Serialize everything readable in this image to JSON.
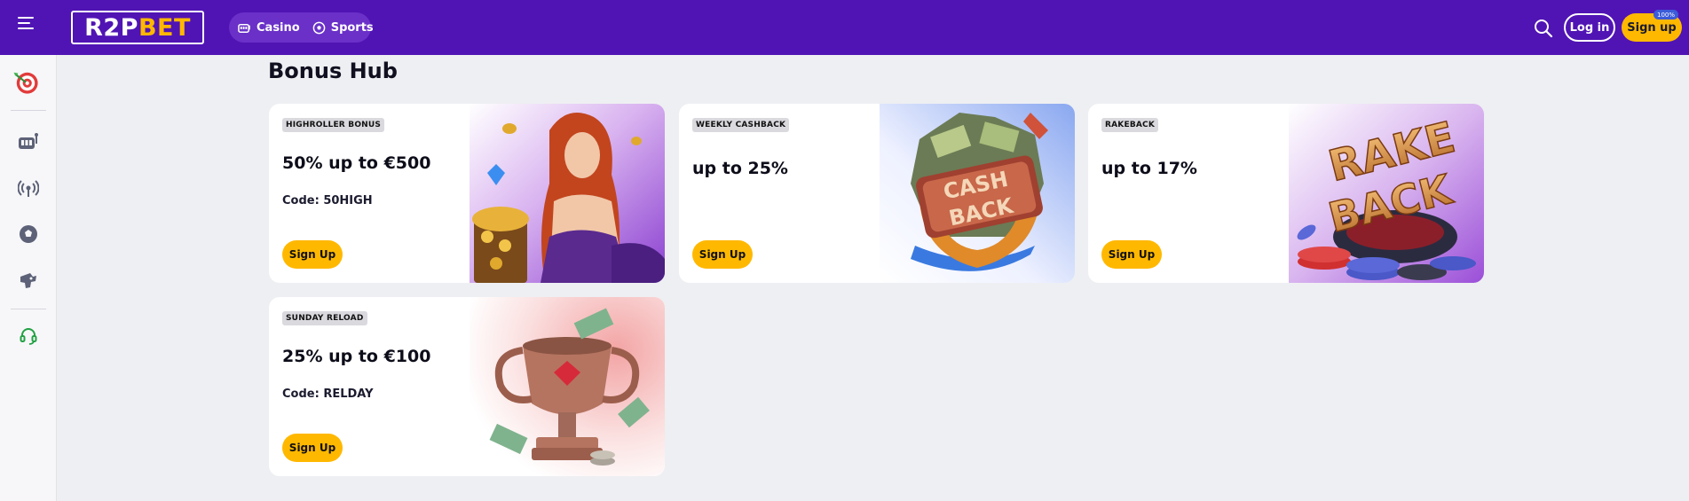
{
  "header": {
    "logo_part1": "R2P",
    "logo_part2": "BET",
    "nav": [
      {
        "label": "Casino",
        "icon": "slot-machine-icon"
      },
      {
        "label": "Sports",
        "icon": "soccer-ball-icon"
      }
    ],
    "login_label": "Log in",
    "signup_label": "Sign up",
    "signup_badge": "100%"
  },
  "sidebar": {
    "items": [
      {
        "icon": "dart-board-icon"
      },
      {
        "icon": "slot-machine-icon"
      },
      {
        "icon": "live-broadcast-icon"
      },
      {
        "icon": "soccer-ball-icon"
      },
      {
        "icon": "esports-icon"
      },
      {
        "icon": "support-headset-icon"
      }
    ]
  },
  "main": {
    "title": "Bonus Hub",
    "cards": [
      {
        "badge": "HIGHROLLER BONUS",
        "headline": "50% up to €500",
        "code": "Code: 50HIGH",
        "button": "Sign Up",
        "art": "sorceress-treasure-chest"
      },
      {
        "badge": "WEEKLY CASHBACK",
        "headline": "up to 25%",
        "code": "",
        "button": "Sign Up",
        "art": "cashback-sign"
      },
      {
        "badge": "RAKEBACK",
        "headline": "up to 17%",
        "code": "",
        "button": "Sign Up",
        "art": "rakeback-poker-chips"
      },
      {
        "badge": "SUNDAY RELOAD",
        "headline": "25% up to €100",
        "code": "Code: RELDAY",
        "button": "Sign Up",
        "art": "trophy-with-cash"
      }
    ]
  },
  "colors": {
    "header_bg": "#5014b4",
    "accent_yellow": "#ffb800",
    "page_bg": "#eeeff2"
  }
}
